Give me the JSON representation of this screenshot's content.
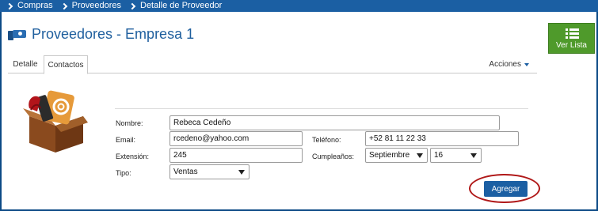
{
  "breadcrumb": [
    "Compras",
    "Proveedores",
    "Detalle de Proveedor"
  ],
  "header": {
    "title": "Proveedores - Empresa 1",
    "icon": "handshake-icon"
  },
  "list_button": {
    "label": "Ver Lista",
    "icon": "list-icon"
  },
  "tabs": [
    {
      "label": "Detalle"
    },
    {
      "label": "Contactos"
    }
  ],
  "actions_menu": {
    "label": "Acciones"
  },
  "form": {
    "nombre": {
      "label": "Nombre:",
      "value": "Rebeca Cedeño"
    },
    "email": {
      "label": "Email:",
      "value": "rcedeno@yahoo.com"
    },
    "telefono": {
      "label": "Teléfono:",
      "value": "+52 81 11 22 33"
    },
    "extension": {
      "label": "Extensión:",
      "value": "245"
    },
    "cumpleanos": {
      "label": "Cumpleaños:",
      "month": "Septiembre",
      "day": "16"
    },
    "tipo": {
      "label": "Tipo:",
      "value": "Ventas"
    }
  },
  "add_button": {
    "label": "Agregar"
  },
  "colors": {
    "brand_blue": "#1b5fa3",
    "list_green": "#4f9a2b",
    "highlight_red": "#b01818"
  }
}
